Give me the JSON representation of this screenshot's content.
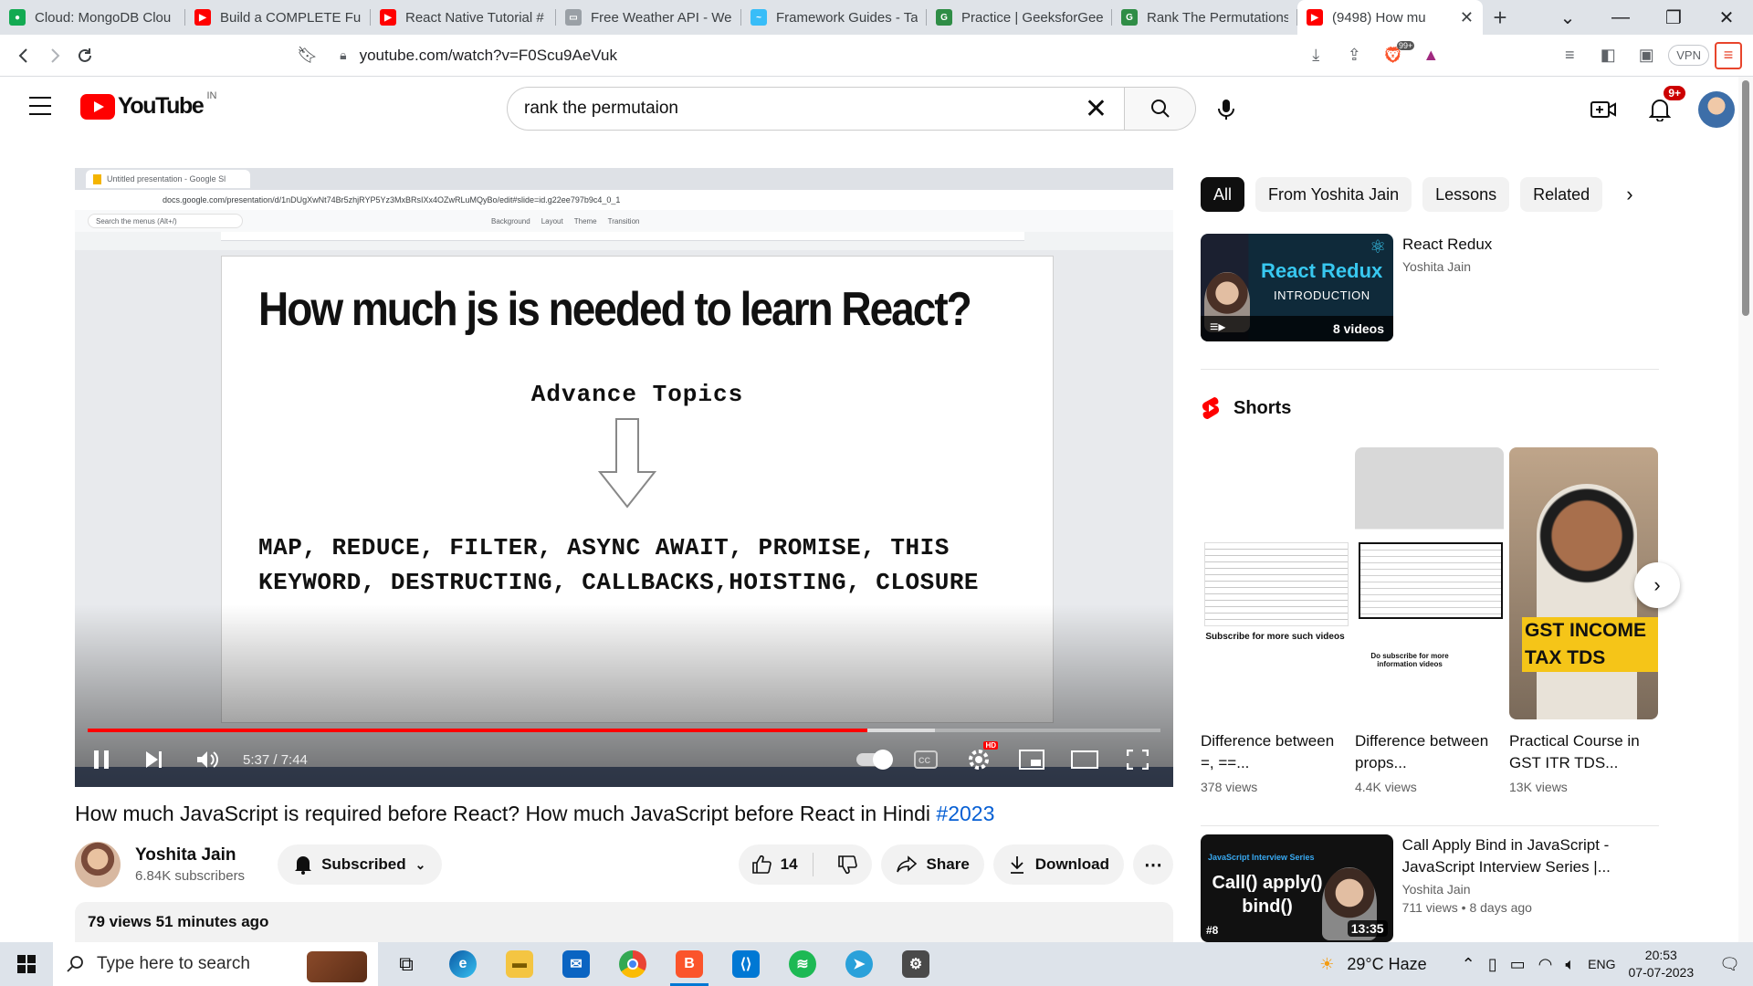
{
  "browser": {
    "tabs": [
      {
        "title": "Cloud: MongoDB Clou",
        "color": "#13aa52",
        "glyph": "●"
      },
      {
        "title": "Build a COMPLETE Full",
        "color": "#ff0000",
        "glyph": "▶"
      },
      {
        "title": "React Native Tutorial #",
        "color": "#ff0000",
        "glyph": "▶"
      },
      {
        "title": "Free Weather API - We",
        "color": "#9aa0a6",
        "glyph": "▭"
      },
      {
        "title": "Framework Guides - Ta",
        "color": "#38bdf8",
        "glyph": "~"
      },
      {
        "title": "Practice | GeeksforGee",
        "color": "#2f8d46",
        "glyph": "G"
      },
      {
        "title": "Rank The Permutations",
        "color": "#2f8d46",
        "glyph": "G"
      },
      {
        "title": "(9498) How mu",
        "color": "#ff0000",
        "glyph": "▶",
        "active": true
      }
    ],
    "url": "youtube.com/watch?v=F0Scu9AeVuk",
    "vpn_label": "VPN",
    "brave_badge": "99+"
  },
  "youtube": {
    "logo_text": "YouTube",
    "country_code": "IN",
    "search_value": "rank the permutaion",
    "notification_count": "9+"
  },
  "player": {
    "slide": {
      "gtab_title": "Untitled presentation - Google Sl",
      "gurl": "docs.google.com/presentation/d/1nDUgXwNt74Br5zhjRYP5Yz3MxBRsIXx4OZwRLuMQyBo/edit#slide=id.g22ee797b9c4_0_1",
      "menu_search": "Search the menus (Alt+/)",
      "menu_items": [
        "Background",
        "Layout",
        "Theme",
        "Transition"
      ],
      "heading": "How much js is needed to learn React?",
      "subheading": "Advance Topics",
      "topics_line1": "MAP, REDUCE, FILTER, ASYNC AWAIT, PROMISE, THIS",
      "topics_line2": "KEYWORD, DESTRUCTING, CALLBACKS,HOISTING, CLOSURE"
    },
    "timecode": "5:37 / 7:44",
    "progress_fraction": 0.7265,
    "buffered_fraction": 0.79,
    "hd_label": "HD"
  },
  "video": {
    "title_main": "How much JavaScript is required before React? How much JavaScript before React in Hindi ",
    "title_tag": "#2023",
    "channel_name": "Yoshita Jain",
    "subscribers": "6.84K subscribers",
    "subscribed_label": "Subscribed",
    "likes": "14",
    "share_label": "Share",
    "download_label": "Download",
    "views_time": "79 views  51 minutes ago"
  },
  "sidebar": {
    "chips": [
      "All",
      "From Yoshita Jain",
      "Lessons",
      "Related"
    ],
    "playlist": {
      "thumb_title": "React Redux",
      "thumb_sub": "INTRODUCTION",
      "count": "8 videos",
      "title": "React Redux",
      "channel": "Yoshita Jain"
    },
    "shorts_heading": "Shorts",
    "shorts": [
      {
        "title": "Difference between =, ==...",
        "views": "378 views",
        "caption": "Subscribe for more such videos"
      },
      {
        "title": "Difference between props...",
        "views": "4.4K views",
        "caption": "Do subscribe for more information videos"
      },
      {
        "title": "Practical Course in GST ITR TDS...",
        "views": "13K views",
        "caption": "GST INCOME TAX TDS"
      }
    ],
    "video2": {
      "series": "JavaScript Interview Series",
      "thumb_text": "Call() apply() bind()",
      "num": "#8",
      "duration": "13:35",
      "title": "Call Apply Bind in JavaScript - JavaScript Interview Series |...",
      "channel": "Yoshita Jain",
      "meta": "711 views  • 8 days ago"
    }
  },
  "taskbar": {
    "search_placeholder": "Type here to search",
    "weather": "29°C  Haze",
    "lang": "ENG",
    "time": "20:53",
    "date": "07-07-2023"
  }
}
